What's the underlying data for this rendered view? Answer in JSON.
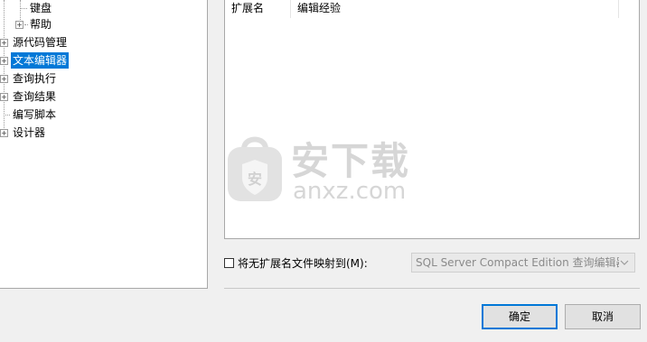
{
  "tree": {
    "items": [
      {
        "label": "键盘"
      },
      {
        "label": "帮助"
      },
      {
        "label": "源代码管理"
      },
      {
        "label": "文本编辑器"
      },
      {
        "label": "查询执行"
      },
      {
        "label": "查询结果"
      },
      {
        "label": "编写脚本"
      },
      {
        "label": "设计器"
      }
    ],
    "expand_glyph": "+"
  },
  "list": {
    "columns": [
      "扩展名",
      "编辑经验"
    ]
  },
  "watermark": {
    "big": "安下载",
    "small": "anxz.com",
    "badge": "安"
  },
  "mapping": {
    "checkbox_label": "将无扩展名文件映射到(M):",
    "checked": false,
    "select_value": "SQL Server Compact Edition 查询编辑器"
  },
  "buttons": {
    "ok": "确定",
    "cancel": "取消"
  },
  "colors": {
    "accent": "#0078d7"
  }
}
